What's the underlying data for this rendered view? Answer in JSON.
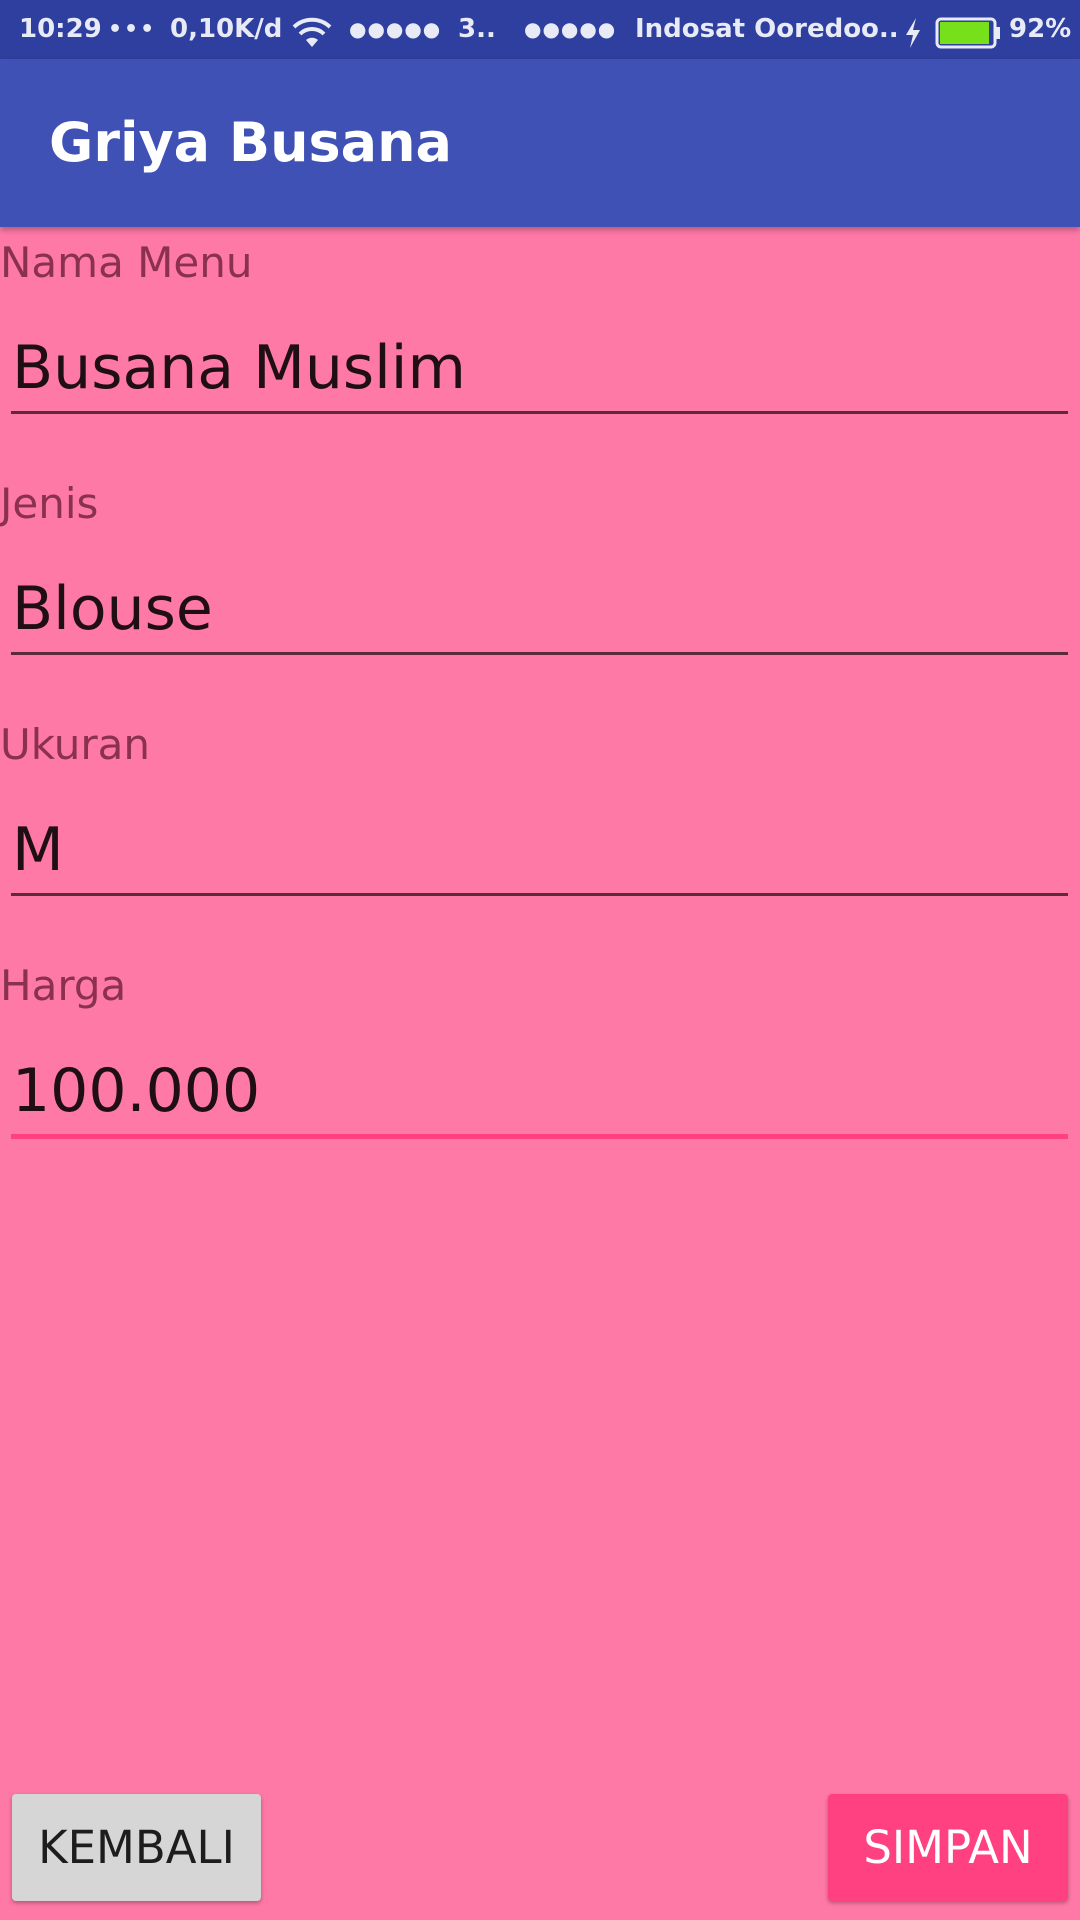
{
  "status_bar": {
    "time": "10:29",
    "notification_dots": "•••",
    "network_speed": "0,10K/d",
    "wifi_icon": "wifi-icon",
    "signal_1": "●●●●●",
    "network_type": "3..",
    "signal_2": "●●●●●",
    "carrier": "Indosat Ooredoo..",
    "charging_icon": "lightning-icon",
    "battery_icon": "battery-icon",
    "battery_level": 0.92,
    "battery_percent": "92%",
    "battery_color": "#76e01a"
  },
  "app_bar": {
    "title": "Griya Busana",
    "color": "#3f51b5"
  },
  "form": {
    "fields": [
      {
        "label": "Nama Menu",
        "value": "Busana Muslim"
      },
      {
        "label": "Jenis",
        "value": "Blouse"
      },
      {
        "label": "Ukuran",
        "value": "M"
      },
      {
        "label": "Harga",
        "value": "100.000"
      }
    ],
    "background": "#ff79a7",
    "accent": "#ff4081"
  },
  "actions": {
    "back_label": "KEMBALI",
    "save_label": "SIMPAN"
  }
}
